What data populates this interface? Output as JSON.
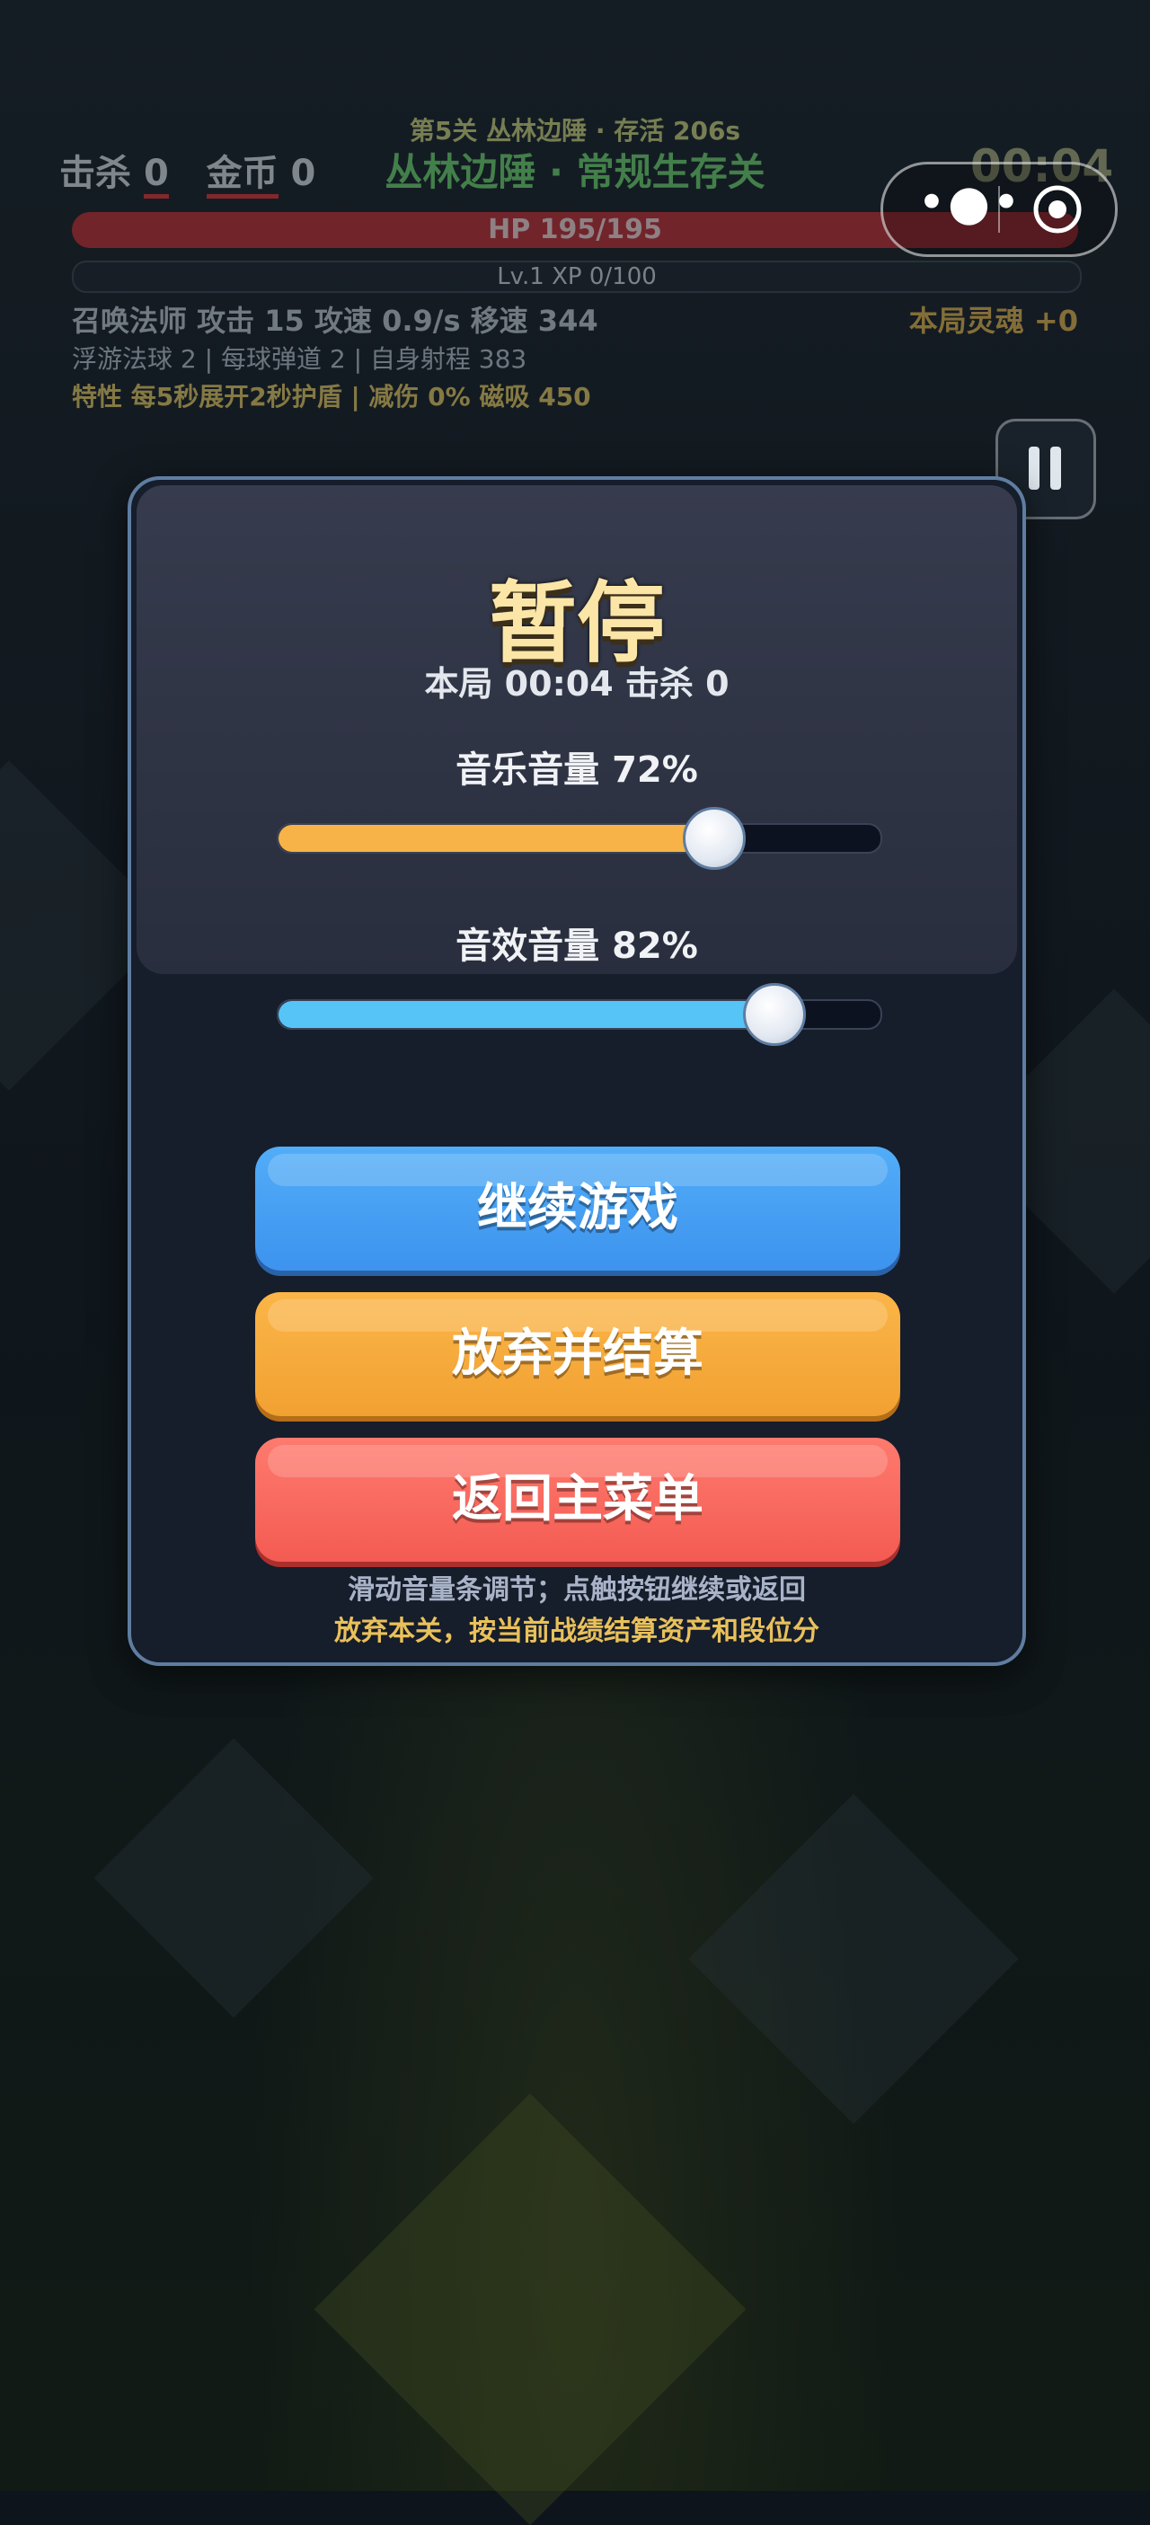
{
  "hud": {
    "kills_label": "击杀",
    "kills_value": "0",
    "coins_label": "金币",
    "coins_value": "0",
    "stage_small": "第5关 丛林边陲 · 存活 206s",
    "stage_big": "丛林边陲 · 常规生存关",
    "timer": "00:04",
    "hp_text": "HP 195/195",
    "xp_text": "Lv.1  XP 0/100",
    "stats_line1": "召唤法师  攻击 15   攻速 0.9/s   移速 344",
    "soul": "本局灵魂 +0",
    "stats_line2": "浮游法球 2 | 每球弹道 2 | 自身射程 383",
    "stats_line3": "特性 每5秒展开2秒护盾 | 减伤 0% 磁吸 450"
  },
  "pause": {
    "title": "暂停",
    "session": "本局 00:04  击杀 0",
    "music_label": "音乐音量  72%",
    "music_value": 0.72,
    "sfx_label": "音效音量  82%",
    "sfx_value": 0.82,
    "continue_label": "继续游戏",
    "abandon_label": "放弃并结算",
    "menu_label": "返回主菜单",
    "hint_line1": "滑动音量条调节；点触按钮继续或返回",
    "hint_line2": "放弃本关，按当前战绩结算资产和段位分"
  },
  "colors": {
    "music_fill": "#f7b347",
    "sfx_fill": "#56c4f7",
    "hint_line1": "#a9b3c8",
    "hint_line2": "#e9c15a"
  },
  "icons": {
    "more": "more-dots-icon",
    "close": "target-circle-icon",
    "pause": "pause-icon"
  }
}
